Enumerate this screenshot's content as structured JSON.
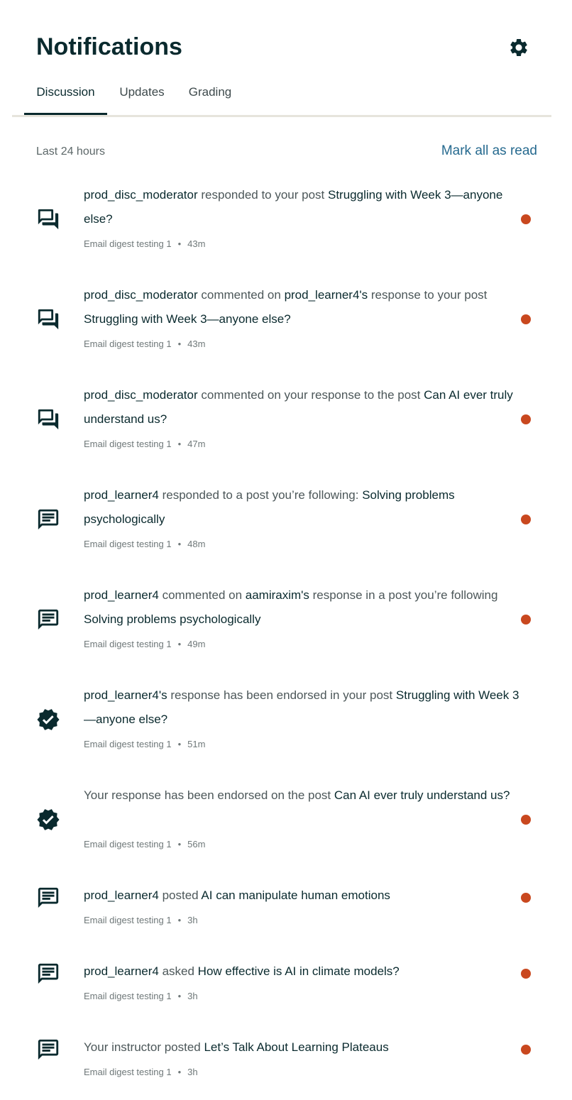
{
  "header": {
    "title": "Notifications",
    "settings_icon": "gear-icon"
  },
  "tabs": [
    {
      "label": "Discussion",
      "active": true
    },
    {
      "label": "Updates",
      "active": false
    },
    {
      "label": "Grading",
      "active": false
    }
  ],
  "section": {
    "label": "Last 24 hours",
    "mark_all": "Mark all as read"
  },
  "colors": {
    "unread_dot": "#c9481f",
    "link": "#266a8f",
    "text_dark": "#0a2a2e"
  },
  "notifications": [
    {
      "icon": "question-answer-icon",
      "parts": [
        {
          "text": "prod_disc_moderator",
          "strong": true
        },
        {
          "text": " responded to your post ",
          "strong": false
        },
        {
          "text": "Struggling with Week 3—anyone else?",
          "strong": true
        }
      ],
      "course": "Email digest testing 1",
      "time": "43m",
      "unread": true
    },
    {
      "icon": "question-answer-icon",
      "parts": [
        {
          "text": "prod_disc_moderator",
          "strong": true
        },
        {
          "text": " commented on ",
          "strong": false
        },
        {
          "text": "prod_learner4's",
          "strong": true
        },
        {
          "text": " response to your post ",
          "strong": false
        },
        {
          "text": "Struggling with Week 3—anyone else?",
          "strong": true
        }
      ],
      "course": "Email digest testing 1",
      "time": "43m",
      "unread": true
    },
    {
      "icon": "question-answer-icon",
      "parts": [
        {
          "text": "prod_disc_moderator",
          "strong": true
        },
        {
          "text": " commented on your response to the post ",
          "strong": false
        },
        {
          "text": "Can AI ever truly understand us?",
          "strong": true
        }
      ],
      "course": "Email digest testing 1",
      "time": "47m",
      "unread": true
    },
    {
      "icon": "chat-message-icon",
      "parts": [
        {
          "text": "prod_learner4",
          "strong": true
        },
        {
          "text": " responded to a post you’re following: ",
          "strong": false
        },
        {
          "text": "Solving problems psychologically",
          "strong": true
        }
      ],
      "course": "Email digest testing 1",
      "time": "48m",
      "unread": true
    },
    {
      "icon": "chat-message-icon",
      "parts": [
        {
          "text": "prod_learner4",
          "strong": true
        },
        {
          "text": " commented on ",
          "strong": false
        },
        {
          "text": "aamiraxim's",
          "strong": true
        },
        {
          "text": " response in a post you’re following ",
          "strong": false
        },
        {
          "text": "Solving problems psychologically",
          "strong": true
        }
      ],
      "course": "Email digest testing 1",
      "time": "49m",
      "unread": true
    },
    {
      "icon": "verified-badge-icon",
      "parts": [
        {
          "text": "prod_learner4's",
          "strong": true
        },
        {
          "text": " response has been endorsed in your post ",
          "strong": false
        },
        {
          "text": "Struggling with Week 3—anyone else?",
          "strong": true
        }
      ],
      "course": "Email digest testing 1",
      "time": "51m",
      "unread": false
    },
    {
      "icon": "verified-badge-icon",
      "parts": [
        {
          "text": "Your response has been endorsed on the post ",
          "strong": false
        },
        {
          "text": "Can AI ever truly understand us?",
          "strong": true
        }
      ],
      "course": "Email digest testing 1",
      "time": "56m",
      "unread": true
    },
    {
      "icon": "chat-message-icon",
      "parts": [
        {
          "text": "prod_learner4",
          "strong": true
        },
        {
          "text": " posted ",
          "strong": false
        },
        {
          "text": "AI can manipulate human emotions",
          "strong": true
        }
      ],
      "course": "Email digest testing 1",
      "time": "3h",
      "unread": true
    },
    {
      "icon": "chat-message-icon",
      "parts": [
        {
          "text": "prod_learner4",
          "strong": true
        },
        {
          "text": " asked ",
          "strong": false
        },
        {
          "text": "How effective is AI in climate models?",
          "strong": true
        }
      ],
      "course": "Email digest testing 1",
      "time": "3h",
      "unread": true
    },
    {
      "icon": "chat-message-icon",
      "parts": [
        {
          "text": "Your instructor posted ",
          "strong": false
        },
        {
          "text": "Let’s Talk About Learning Plateaus",
          "strong": true
        }
      ],
      "course": "Email digest testing 1",
      "time": "3h",
      "unread": true
    }
  ]
}
